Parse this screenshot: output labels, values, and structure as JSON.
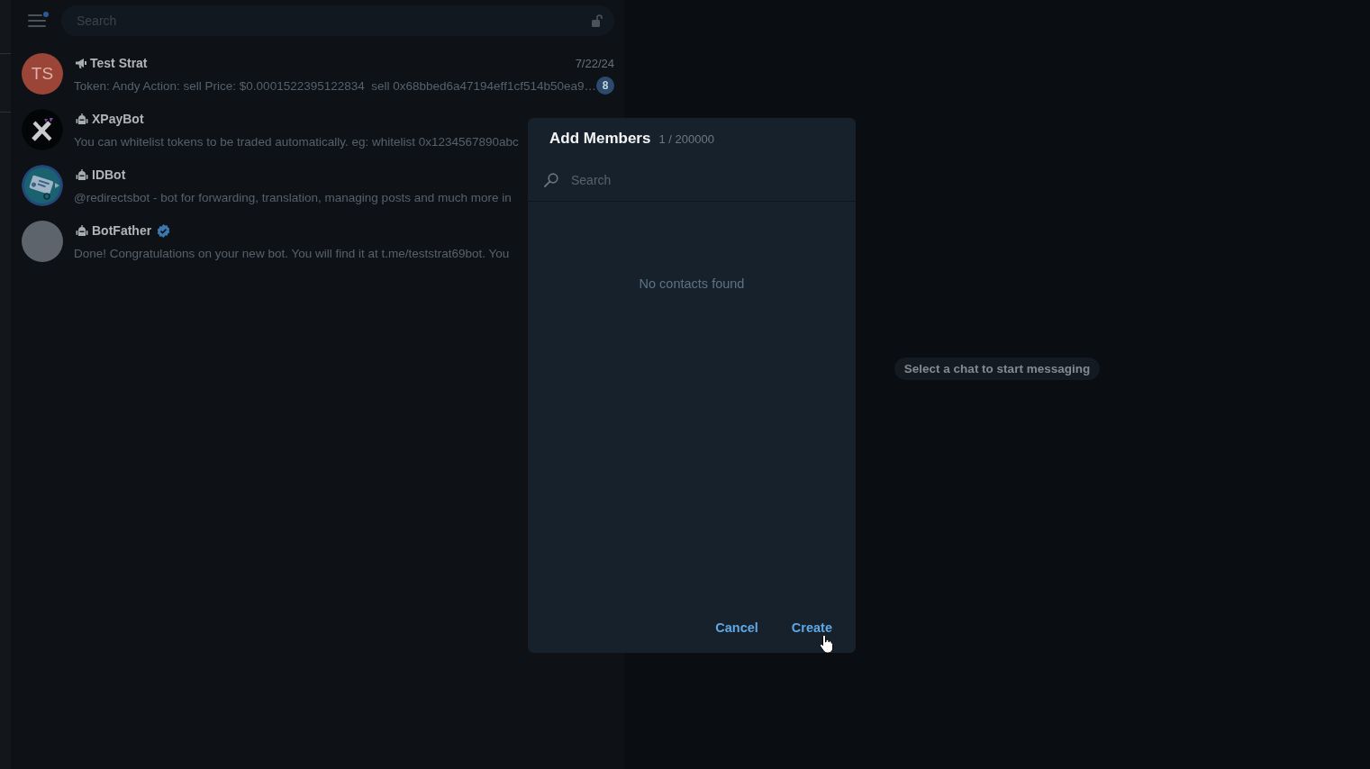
{
  "header": {
    "menu_badge": true,
    "search": {
      "placeholder": "Search"
    },
    "lock": {
      "locked": false
    }
  },
  "chats": [
    {
      "name": "Test Strat",
      "kind": "channel",
      "avatar": {
        "kind": "initials",
        "text": "TS"
      },
      "verified": false,
      "date": "7/22/24",
      "message": "Token: Andy Action: sell Price: $0.0001522395122834  sell 0x68bbed6a47194eff1cf514b50ea9…",
      "unread": "8"
    },
    {
      "name": "XPayBot",
      "kind": "bot",
      "avatar": {
        "kind": "x-logo"
      },
      "verified": false,
      "message": "You can whitelist tokens to be traded automatically. eg: whitelist 0x1234567890abc"
    },
    {
      "name": "IDBot",
      "kind": "bot",
      "avatar": {
        "kind": "id-card"
      },
      "verified": false,
      "message": "@redirectsbot - bot for forwarding, translation, managing posts and much more in"
    },
    {
      "name": "BotFather",
      "kind": "bot",
      "avatar": {
        "kind": "photo"
      },
      "verified": true,
      "message": "Done! Congratulations on your new bot. You will find it at t.me/teststrat69bot. You"
    }
  ],
  "chat_area": {
    "empty_state": "Select a chat to start messaging"
  },
  "dialog": {
    "title": "Add Members",
    "count": "1 / 200000",
    "search": {
      "placeholder": "Search"
    },
    "empty_text": "No contacts found",
    "buttons": [
      {
        "label": "Cancel"
      },
      {
        "label": "Create"
      }
    ]
  }
}
